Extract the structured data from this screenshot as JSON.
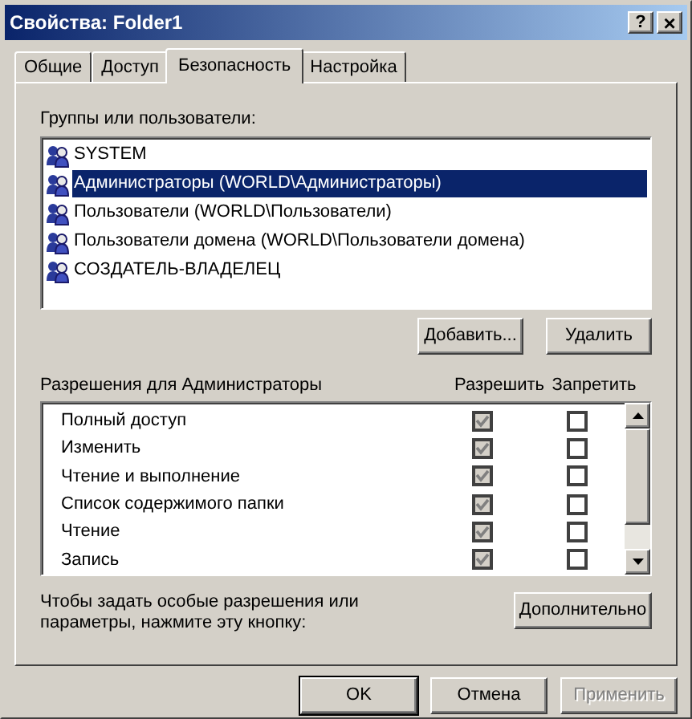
{
  "window": {
    "title": "Свойства: Folder1",
    "help_button": "?",
    "close_button": "×"
  },
  "tabs": [
    {
      "label": "Общие",
      "selected": false
    },
    {
      "label": "Доступ",
      "selected": false
    },
    {
      "label": "Безопасность",
      "selected": true
    },
    {
      "label": "Настройка",
      "selected": false
    }
  ],
  "groups": {
    "label": "Группы или пользователи:",
    "items": [
      {
        "name": "SYSTEM",
        "selected": false
      },
      {
        "name": "Администраторы (WORLD\\Администраторы)",
        "selected": true
      },
      {
        "name": "Пользователи (WORLD\\Пользователи)",
        "selected": false
      },
      {
        "name": "Пользователи домена (WORLD\\Пользователи домена)",
        "selected": false
      },
      {
        "name": "СОЗДАТЕЛЬ-ВЛАДЕЛЕЦ",
        "selected": false
      }
    ]
  },
  "group_buttons": [
    {
      "label": "Добавить..."
    },
    {
      "label": "Удалить"
    }
  ],
  "permissions": {
    "label": "Разрешения для Администраторы",
    "allow_header": "Разрешить",
    "deny_header": "Запретить",
    "rows": [
      {
        "name": "Полный доступ",
        "allow": {
          "checked": true,
          "disabled": true
        },
        "deny": {
          "checked": false,
          "disabled": false
        }
      },
      {
        "name": "Изменить",
        "allow": {
          "checked": true,
          "disabled": true
        },
        "deny": {
          "checked": false,
          "disabled": false
        }
      },
      {
        "name": "Чтение и выполнение",
        "allow": {
          "checked": true,
          "disabled": true
        },
        "deny": {
          "checked": false,
          "disabled": false
        }
      },
      {
        "name": "Список содержимого папки",
        "allow": {
          "checked": true,
          "disabled": true
        },
        "deny": {
          "checked": false,
          "disabled": false
        }
      },
      {
        "name": "Чтение",
        "allow": {
          "checked": true,
          "disabled": true
        },
        "deny": {
          "checked": false,
          "disabled": false
        }
      },
      {
        "name": "Запись",
        "allow": {
          "checked": true,
          "disabled": true
        },
        "deny": {
          "checked": false,
          "disabled": false
        }
      }
    ]
  },
  "advanced": {
    "text": "Чтобы задать особые разрешения или параметры, нажмите эту кнопку:",
    "button": "Дополнительно"
  },
  "footer_buttons": [
    {
      "label": "OK",
      "default": true,
      "disabled": false
    },
    {
      "label": "Отмена",
      "default": false,
      "disabled": false
    },
    {
      "label": "Применить",
      "default": false,
      "disabled": true
    }
  ]
}
